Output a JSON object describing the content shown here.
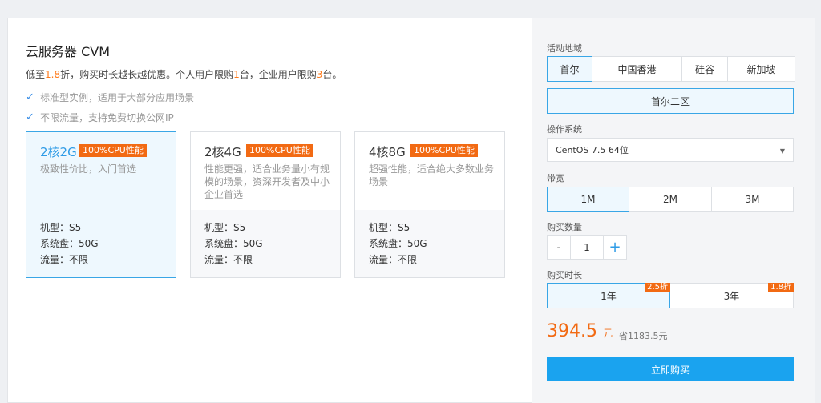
{
  "product": {
    "title": "云服务器 CVM",
    "promo_parts": [
      "低至",
      "1.8",
      "折，购买时长越长越优惠。个人用户限购",
      "1",
      "台，企业用户限购",
      "3",
      "台。"
    ],
    "features": [
      "标准型实例，适用于大部分应用场景",
      "不限流量，支持免费切换公网IP"
    ]
  },
  "plans": [
    {
      "cores": "2核2G",
      "badge": "100%CPU性能",
      "desc": "极致性价比，入门首选",
      "model": "机型：S5",
      "disk": "系统盘：50G",
      "traffic": "流量：不限",
      "selected": true
    },
    {
      "cores": "2核4G",
      "badge": "100%CPU性能",
      "desc": "性能更强，适合业务量小有规模的场景，资深开发者及中小企业首选",
      "model": "机型：S5",
      "disk": "系统盘：50G",
      "traffic": "流量：不限",
      "selected": false
    },
    {
      "cores": "4核8G",
      "badge": "100%CPU性能",
      "desc": "超强性能，适合绝大多数业务场景",
      "model": "机型：S5",
      "disk": "系统盘：50G",
      "traffic": "流量：不限",
      "selected": false
    }
  ],
  "config": {
    "region_label": "活动地域",
    "regions": [
      "首尔",
      "中国香港",
      "硅谷",
      "新加坡"
    ],
    "zone": "首尔二区",
    "os_label": "操作系统",
    "os_value": "CentOS 7.5 64位",
    "bandwidth_label": "带宽",
    "bandwidths": [
      "1M",
      "2M",
      "3M"
    ],
    "qty_label": "购买数量",
    "qty_minus": "-",
    "qty_value": "1",
    "qty_plus": "+",
    "duration_label": "购买时长",
    "durations": [
      {
        "label": "1年",
        "discount": "2.5折"
      },
      {
        "label": "3年",
        "discount": "1.8折"
      }
    ],
    "price": "394.5",
    "price_unit": "元",
    "saving": "省1183.5元",
    "buy_label": "立即购买"
  },
  "colors": {
    "accent": "#1aa3ef",
    "selected_border": "#39a6e6",
    "orange": "#f26a13"
  }
}
